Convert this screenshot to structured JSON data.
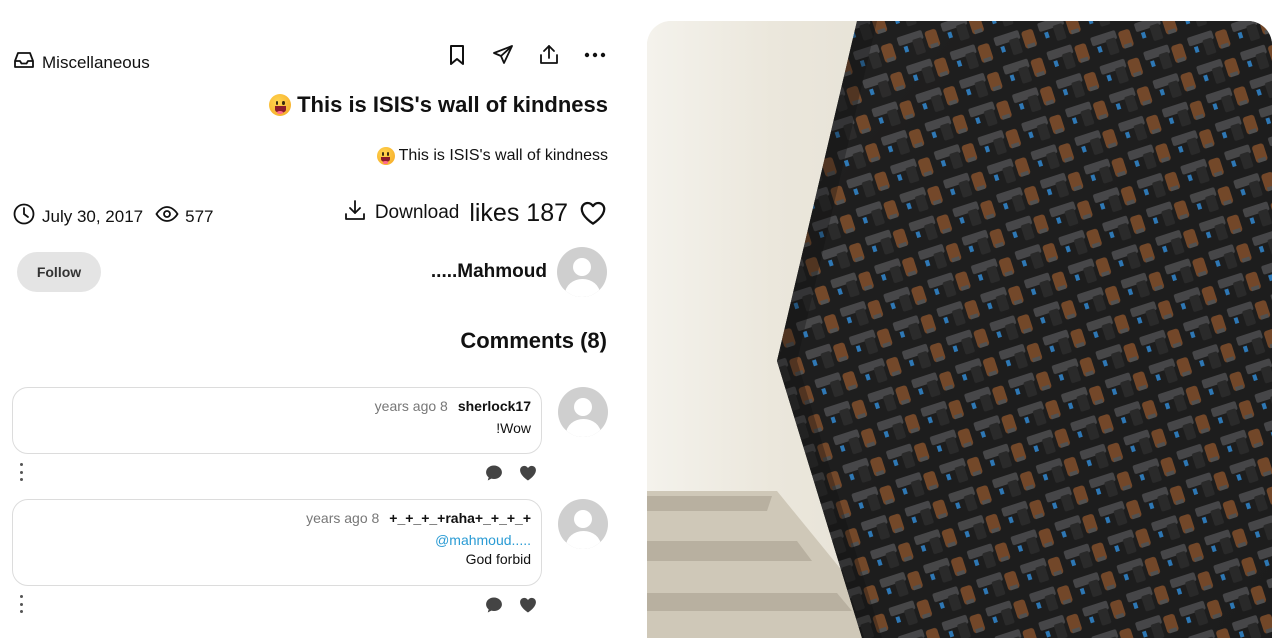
{
  "post": {
    "category": "Miscellaneous",
    "title": "This is ISIS's wall of kindness",
    "subtitle": "This is ISIS's wall of kindness",
    "date": "July 30, 2017",
    "views": "577",
    "download_label": "Download",
    "likes": "likes 187"
  },
  "toolbar": {
    "icons": [
      "bookmark-icon",
      "send-icon",
      "share-icon",
      "more-icon"
    ]
  },
  "author": {
    "name": ".....Mahmoud",
    "follow_label": "Follow"
  },
  "comments": {
    "title": "Comments (8)",
    "items": [
      {
        "time": "years ago 8",
        "user": "sherlock17",
        "mention": "",
        "text": "!Wow"
      },
      {
        "time": "years ago 8",
        "user": "+_+_+_+raha+_+_+_+",
        "mention": "@mahmoud.....",
        "text": "God forbid"
      }
    ]
  },
  "colors": {
    "mention": "#2a9bd4",
    "follow_bg": "#e4e4e4"
  }
}
